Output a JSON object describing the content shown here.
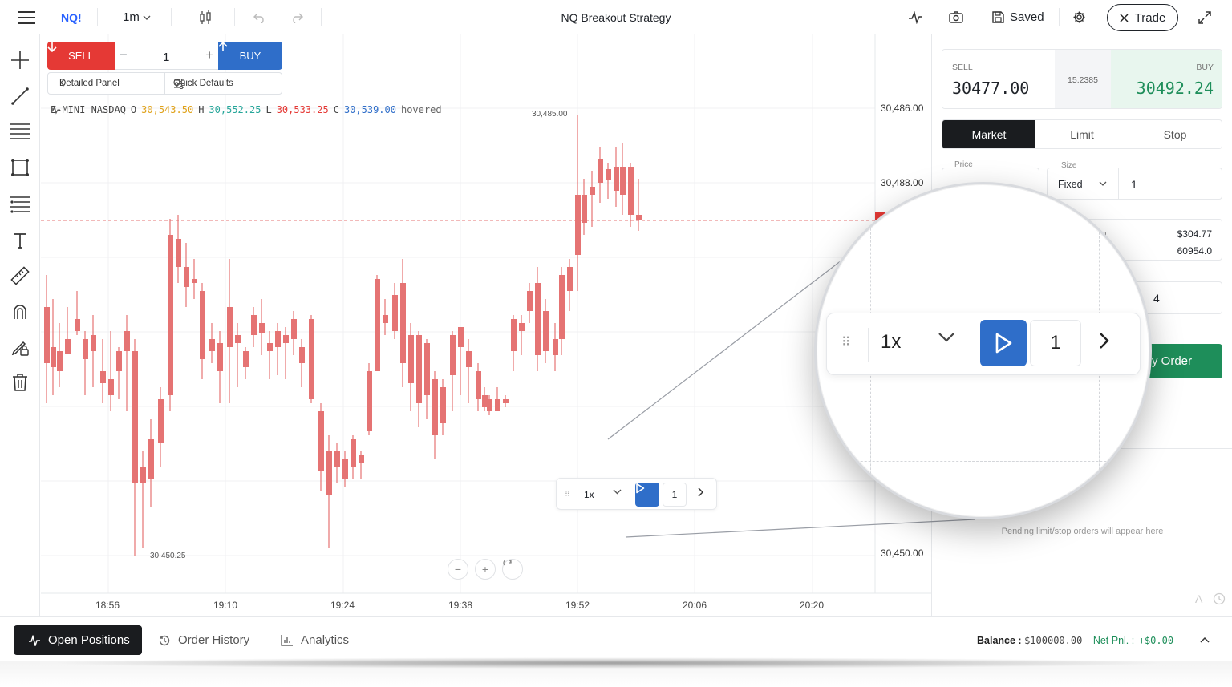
{
  "topbar": {
    "symbol": "NQ!",
    "timeframe": "1m",
    "title": "NQ Breakout Strategy",
    "saved_label": "Saved",
    "trade_label": "Trade"
  },
  "order_widget": {
    "sell_label": "SELL",
    "buy_label": "BUY",
    "quantity": "1",
    "detailed_panel_label": "Detailed Panel",
    "quick_defaults_label": "Quick Defaults"
  },
  "ohlc": {
    "name": "E-MINI NASDAQ",
    "o_label": "O",
    "o": "30,543.50",
    "h_label": "H",
    "h": "30,552.25",
    "l_label": "L",
    "l": "30,533.25",
    "c_label": "C",
    "c": "30,539.00",
    "state": "hovered"
  },
  "price_axis": [
    "30,486.00",
    "30,488.00",
    "30,450.00"
  ],
  "time_axis": [
    "18:56",
    "19:10",
    "19:24",
    "19:38",
    "19:52",
    "20:06",
    "20:20"
  ],
  "annotations": {
    "high": "30,485.00",
    "low": "30,450.25"
  },
  "replay": {
    "speed": "1x",
    "step": "1"
  },
  "right_panel": {
    "sell_label": "SELL",
    "sell_price": "30477.00",
    "spread": "15.2385",
    "buy_label": "BUY",
    "buy_price": "30492.24",
    "order_types": [
      "Market",
      "Limit",
      "Stop"
    ],
    "active_order_type": "Market",
    "price_label": "Price",
    "size_label": "Size",
    "size_mode": "Fixed",
    "size_value": "1",
    "margin_fragment": "in",
    "margin_value": "$304.77",
    "notional_value": "60954.0",
    "field_fragment": "4",
    "order_button": "y Order",
    "pending_note": "Pending limit/stop orders will appear here"
  },
  "bottombar": {
    "tabs": [
      "Open Positions",
      "Order History",
      "Analytics"
    ],
    "balance_label": "Balance :",
    "balance_value": "$100000.00",
    "pnl_label": "Net Pnl. :",
    "pnl_value": "+$0.00"
  },
  "colors": {
    "bull": "#26a69a",
    "bear": "#e57373",
    "sell": "#e53935",
    "buy": "#2f6ec9",
    "accent_green": "#1e8e5a"
  },
  "icons": [
    "menu-icon",
    "candles-icon",
    "undo-icon",
    "redo-icon",
    "pulse-icon",
    "camera-icon",
    "save-icon",
    "gear-icon",
    "close-icon",
    "expand-icon"
  ]
}
